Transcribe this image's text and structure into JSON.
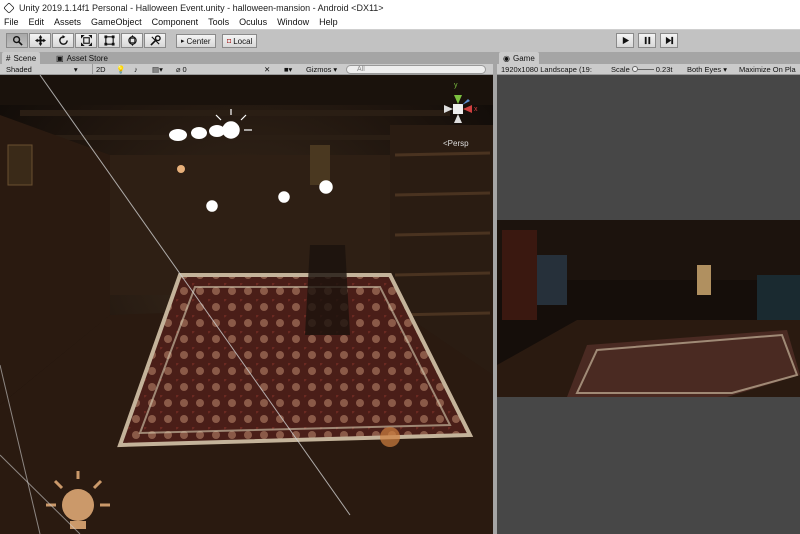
{
  "window": {
    "title": "Unity 2019.1.14f1 Personal - Halloween Event.unity - halloween-mansion - Android <DX11>"
  },
  "menu": [
    "File",
    "Edit",
    "Assets",
    "GameObject",
    "Component",
    "Tools",
    "Oculus",
    "Window",
    "Help"
  ],
  "toolbar": {
    "tools": [
      "hand-tool",
      "move-tool",
      "rotate-tool",
      "scale-tool",
      "rect-tool",
      "transform-tool",
      "custom-tool"
    ],
    "pivot_label": "Center",
    "space_label": "Local"
  },
  "scene_panel": {
    "tab_scene": "Scene",
    "tab_asset_store": "Asset Store",
    "shading": "Shaded",
    "mode_2d": "2D",
    "gizmo_count": "0",
    "gizmos_label": "Gizmos",
    "search_placeholder": "All",
    "persp_label": "Persp",
    "gizmo_axes": {
      "y": "y",
      "x": "x"
    }
  },
  "game_panel": {
    "tab": "Game",
    "resolution": "1920x1080 Landscape (19:",
    "scale_label": "Scale",
    "scale_value": "0.23t",
    "eyes": "Both Eyes",
    "maximize": "Maximize On Pla"
  },
  "colors": {
    "accent_active": "#a8a8a8",
    "panel_bg": "#cbcbcb",
    "game_bg": "#474747",
    "light_icon": "#e8b07a"
  }
}
